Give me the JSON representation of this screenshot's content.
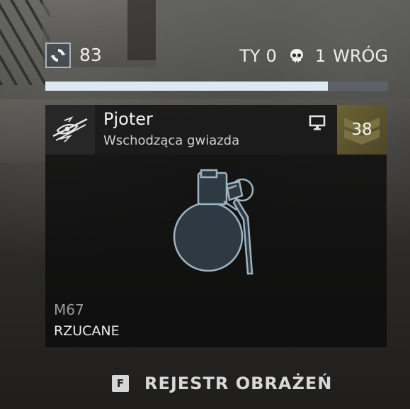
{
  "hud": {
    "ammo": {
      "icon": "supply-refresh-icon",
      "count": "83"
    },
    "score": {
      "you_label": "TY",
      "you_value": "0",
      "enemy_value": "1",
      "enemy_label": "WRÓG",
      "icon": "skull-icon"
    },
    "progress_fraction": 0.825
  },
  "card": {
    "player_name": "Pjoter",
    "player_title": "Wschodząca gwiazda",
    "emblem_icon": "eye-emblem-icon",
    "platform_icon": "pc-monitor-icon",
    "rank": "38",
    "weapon_icon": "grenade-icon",
    "weapon_name": "M67",
    "weapon_type": "RZUCANE"
  },
  "prompt": {
    "key": "F",
    "label": "REJESTR OBRAŻEŃ"
  },
  "colors": {
    "progress_fill": "#dce9f3",
    "progress_track": "#5d6066",
    "rank_bg": "#5c5430",
    "weapon_stroke": "#9fb3c0"
  }
}
